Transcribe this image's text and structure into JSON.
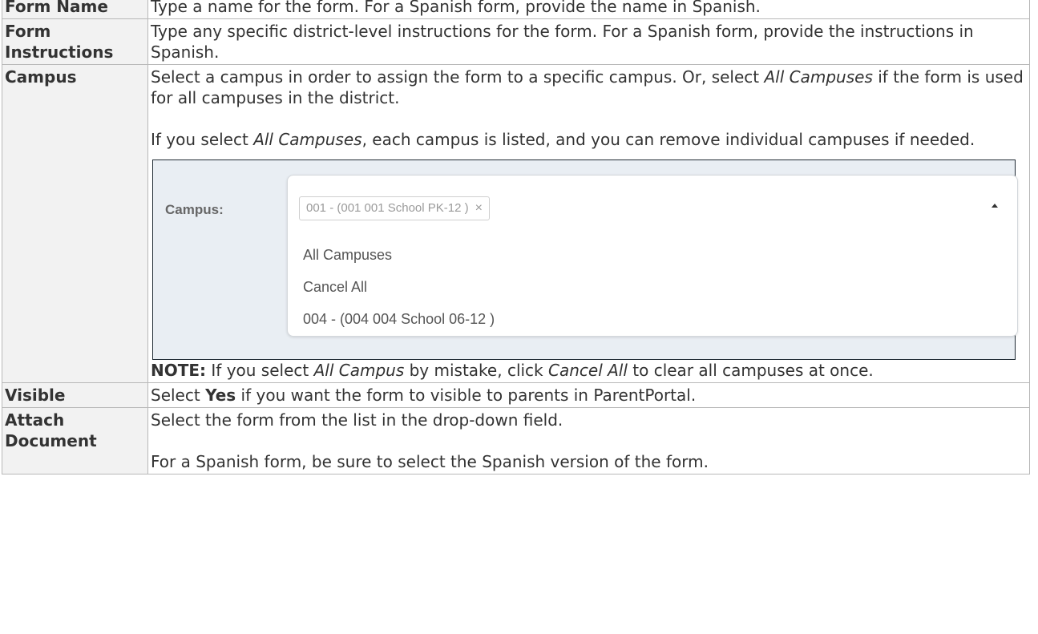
{
  "rows": {
    "form_name": {
      "label": "Form Name",
      "text": "Type a name for the form. For a Spanish form, provide the name in Spanish."
    },
    "form_instructions": {
      "label_line1": "Form",
      "label_line2": "Instructions",
      "text": "Type any specific district-level instructions for the form. For a Spanish form, provide the instructions in Spanish."
    },
    "campus": {
      "label": "Campus",
      "p1_a": "Select a campus in order to assign the form to a specific campus. Or, select ",
      "p1_em": "All Campuses",
      "p1_b": " if the form is used for all campuses in the district.",
      "p2_a": "If you select ",
      "p2_em": "All Campuses",
      "p2_b": ", each campus is listed, and you can remove individual campuses if needed.",
      "screenshot": {
        "field_label": "Campus:",
        "selected_chip": "001 - (001 001 School PK-12 )",
        "chip_remove": "×",
        "options": [
          "All Campuses",
          "Cancel All",
          "004 - (004 004 School 06-12 )"
        ]
      },
      "note_label": "NOTE:",
      "note_a": " If you select ",
      "note_em1": "All Campus",
      "note_b": " by mistake, click ",
      "note_em2": "Cancel All",
      "note_c": " to clear all campuses at once."
    },
    "visible": {
      "label": "Visible",
      "text_a": "Select ",
      "text_bold": "Yes",
      "text_b": " if you want the form to visible to parents in ParentPortal."
    },
    "attach_document": {
      "label_line1": "Attach",
      "label_line2": "Document",
      "p1": "Select the form from the list in the drop-down field.",
      "p2": "For a Spanish form, be sure to select the Spanish version of the form."
    }
  }
}
